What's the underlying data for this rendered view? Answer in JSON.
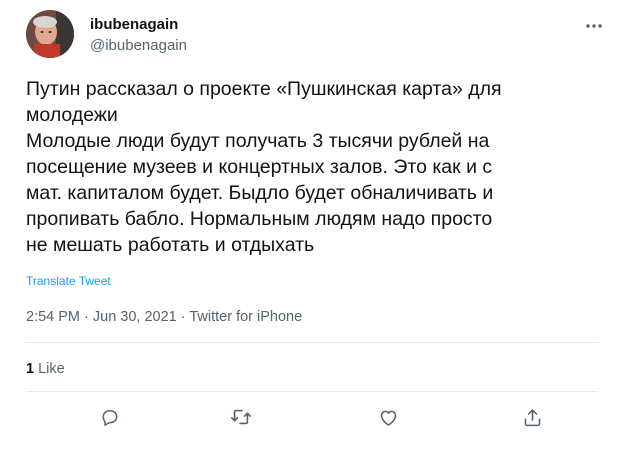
{
  "tweet": {
    "display_name": "ibubenagain",
    "handle": "@ibubenagain",
    "text_lines": [
      "Путин рассказал о проекте «Пушкинская карта» для",
      "молодежи",
      "Молодые люди будут получать 3 тысячи рублей на",
      "посещение музеев и концертных залов. Это как и с",
      "мат. капиталом будет. Быдло будет обналичивать и",
      "пропивать бабло. Нормальным людям надо просто",
      "не мешать работать и отдыхать"
    ],
    "translate_label": "Translate Tweet",
    "timestamp": "2:54 PM · Jun 30, 2021 · Twitter for iPhone",
    "like_count": "1",
    "like_label": "Like"
  },
  "icons": {
    "avatar": "avatar",
    "more": "more-icon",
    "reply": "reply-icon",
    "retweet": "retweet-icon",
    "like": "like-icon",
    "share": "share-icon"
  },
  "colors": {
    "text": "#0f1419",
    "secondary": "#536471",
    "link": "#1d9bf0",
    "divider": "#e4e8eb"
  }
}
